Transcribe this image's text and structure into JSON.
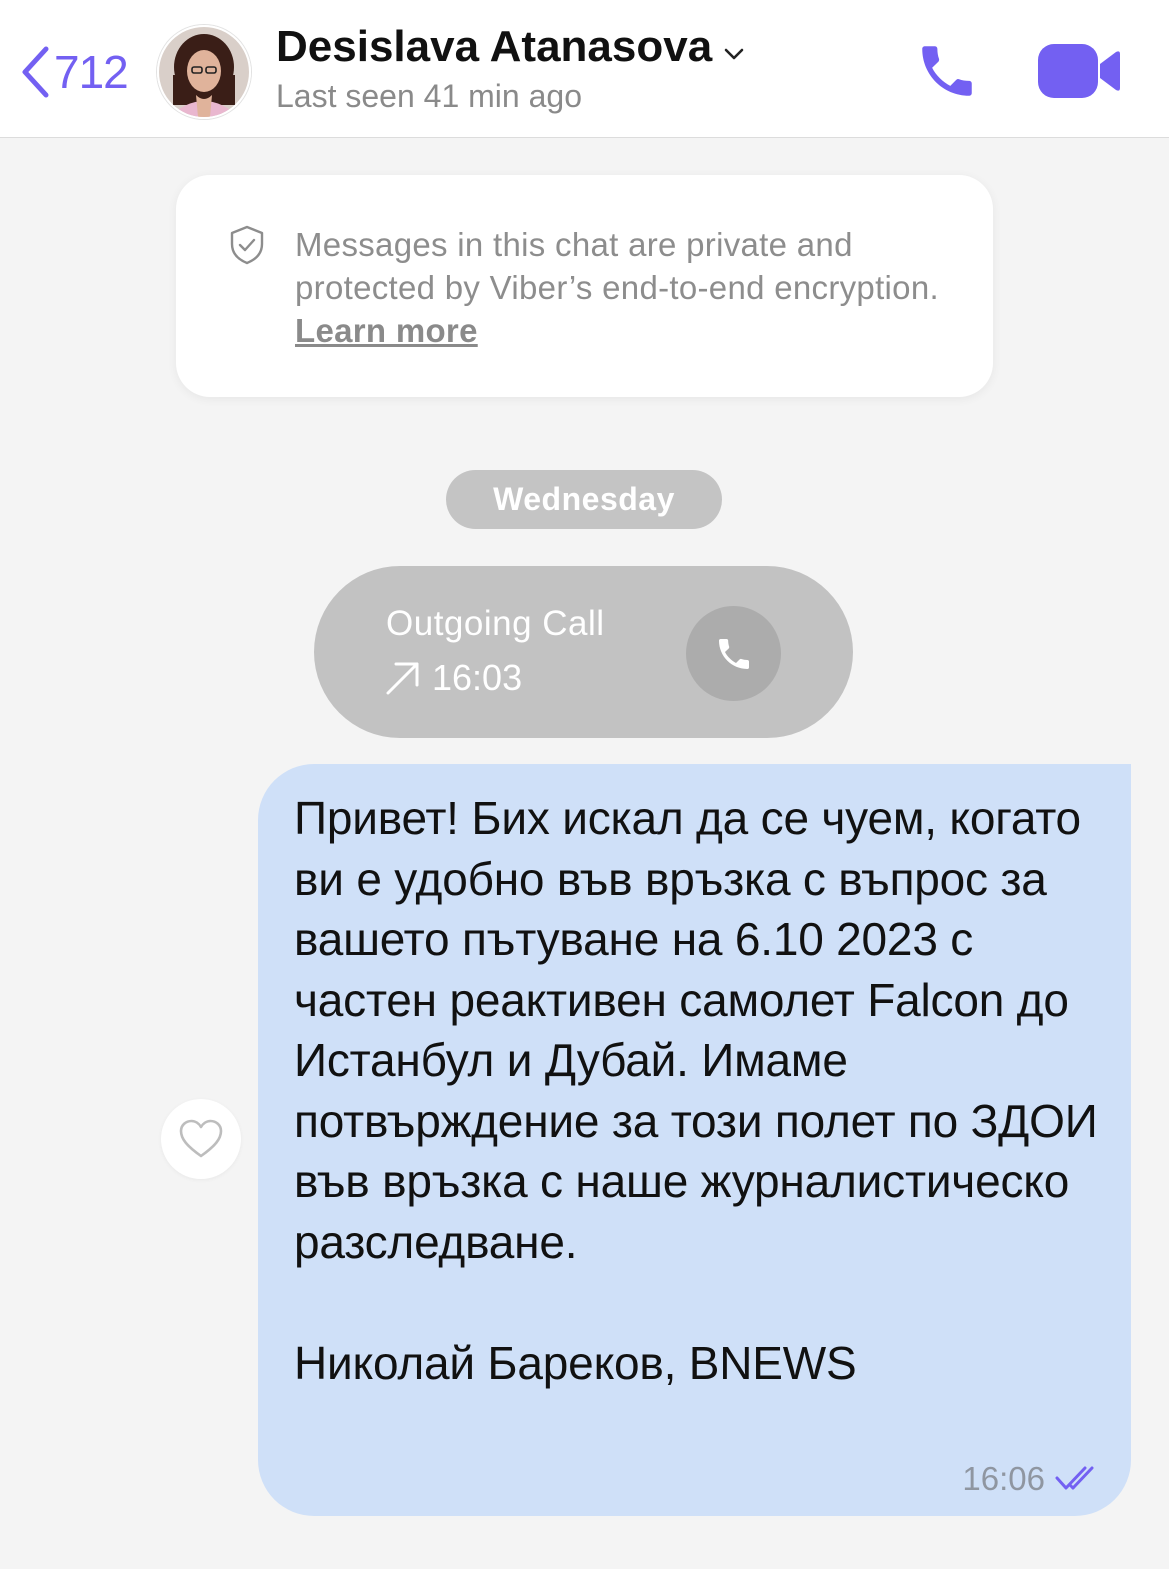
{
  "header": {
    "back_count": "712",
    "contact_name": "Desislava Atanasova",
    "status": "Last seen 41 min ago",
    "accent_color": "#7360f2"
  },
  "notice": {
    "text": "Messages in this chat are private and protected by Viber’s end-to-end encryption. ",
    "link": "Learn more"
  },
  "day_separator": "Wednesday",
  "call": {
    "title": "Outgoing Call",
    "time": "16:03"
  },
  "message": {
    "text": "Привет! Бих искал да се чуем, когато ви е удобно във връзка с въпрос за вашето пътуване на 6.10 2023 с частен реактивен самолет Falcon до Истанбул и Дубай. Имаме потвърждение за този полет по ЗДОИ във връзка с наше журналистическо разследване.\n\nНиколай Бареков, BNEWS",
    "time": "16:06",
    "status_icon": "double-check-icon"
  }
}
